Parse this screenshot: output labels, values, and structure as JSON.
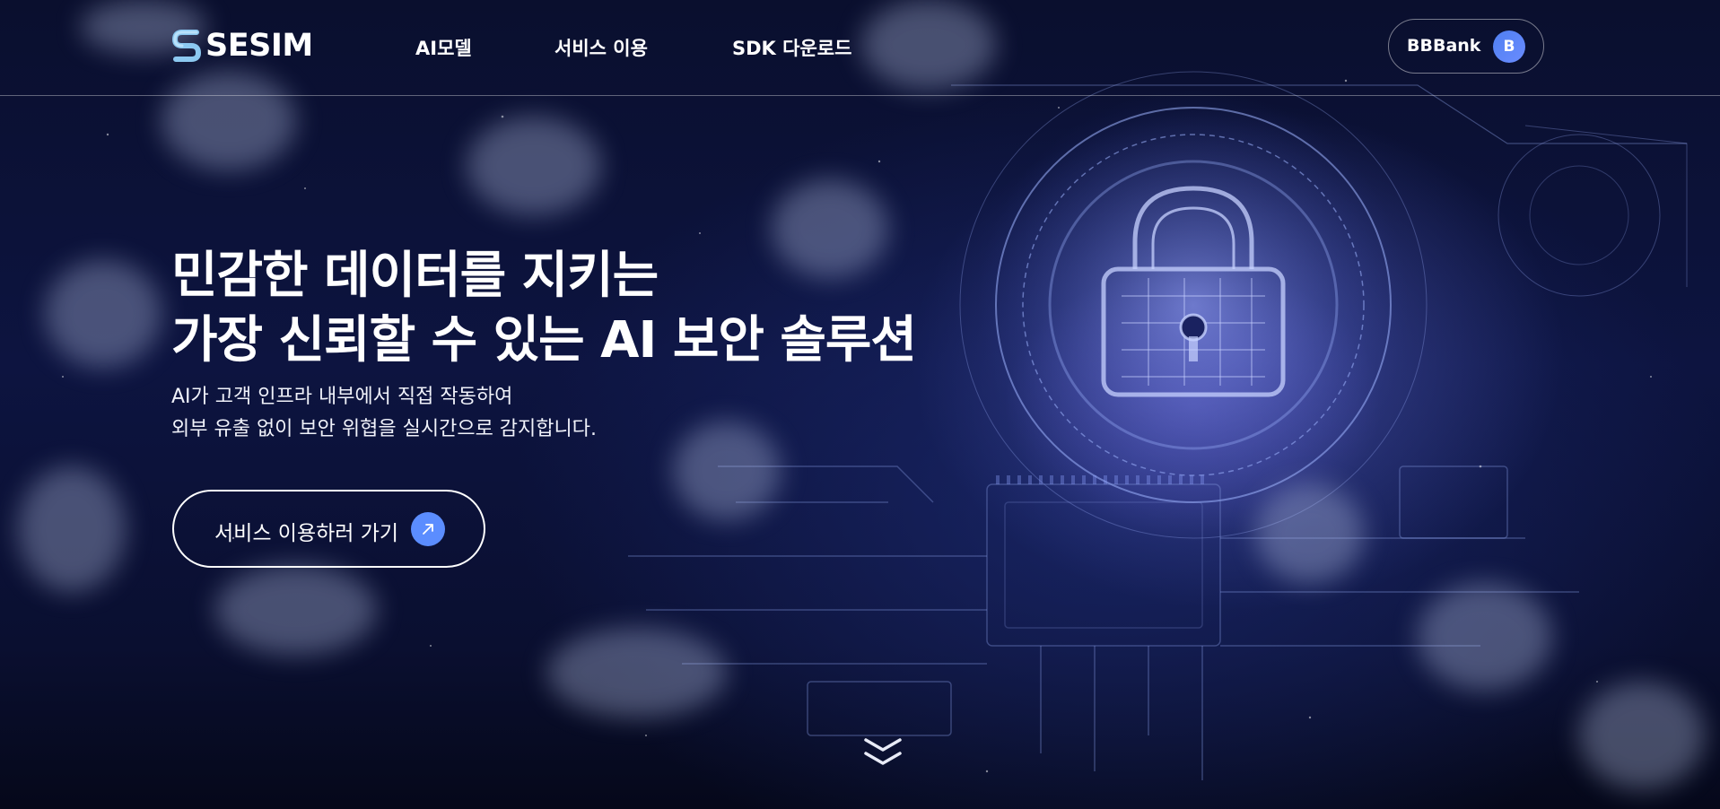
{
  "brand": {
    "name": "SESIM"
  },
  "nav": {
    "items": [
      {
        "label": "AI모델"
      },
      {
        "label": "서비스 이용"
      },
      {
        "label": "SDK 다운로드"
      }
    ]
  },
  "user": {
    "name": "BBBank",
    "avatar_initial": "B"
  },
  "hero": {
    "title_line1": "민감한 데이터를 지키는",
    "title_line2": "가장 신뢰할 수 있는 AI 보안 솔루션",
    "desc_line1": "AI가 고객 인프라 내부에서 직접 작동하여",
    "desc_line2": "외부 유출 없이 보안 위협을 실시간으로 감지합니다.",
    "cta_label": "서비스 이용하러 가기"
  },
  "icons": {
    "cta": "arrow-up-right-icon",
    "scroll": "double-chevron-down-icon",
    "logo": "s-logo-icon"
  },
  "colors": {
    "accent": "#5b8dff",
    "background": "#0b1030",
    "text": "#ffffff"
  }
}
